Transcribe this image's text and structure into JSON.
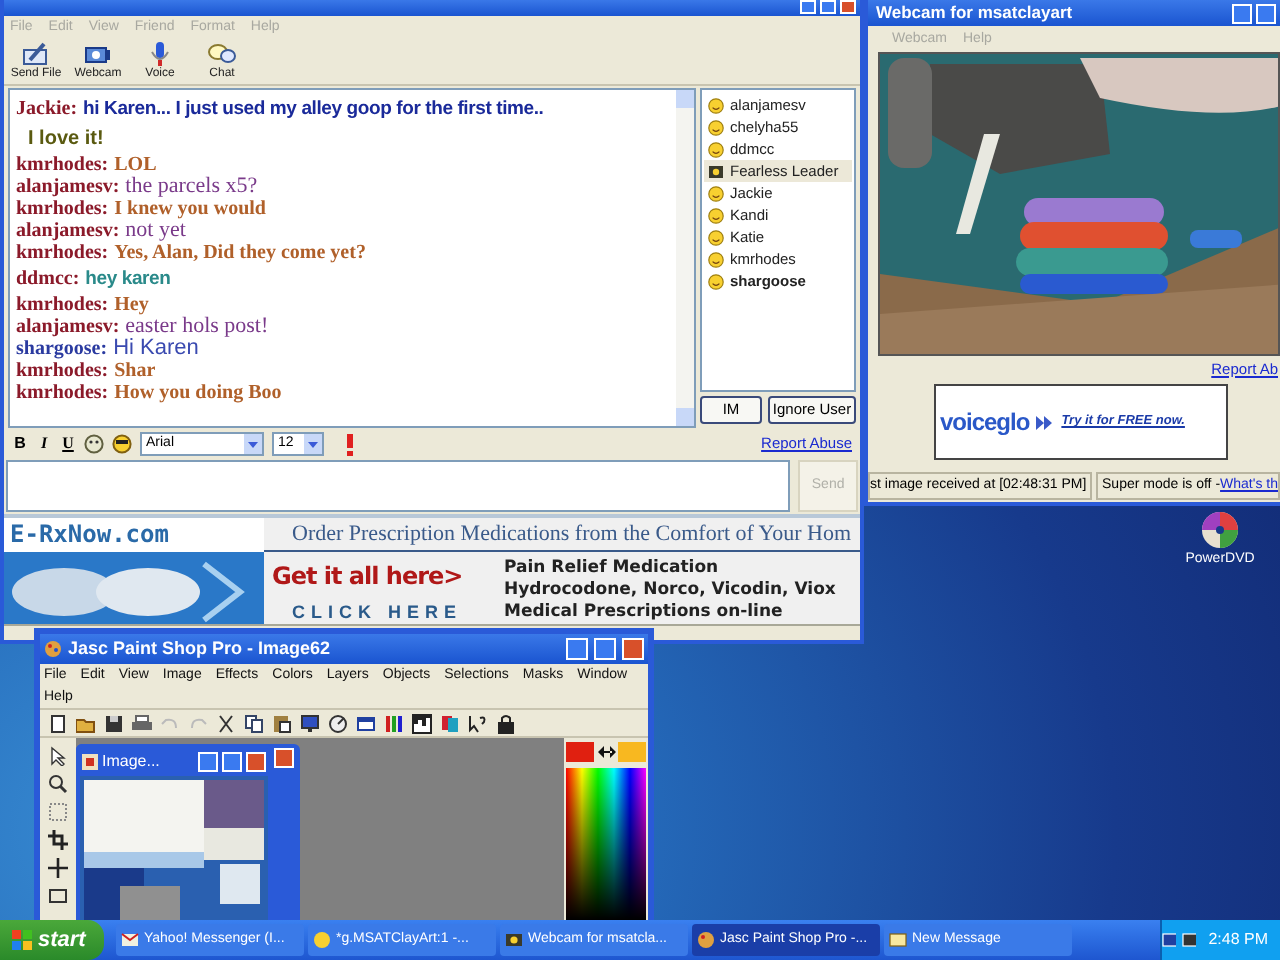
{
  "chat_window": {
    "menu": [
      "File",
      "Edit",
      "View",
      "Friend",
      "Format",
      "Help"
    ],
    "toolbar": [
      {
        "label": "Send File",
        "kind": "send"
      },
      {
        "label": "Webcam",
        "kind": "webcam"
      },
      {
        "label": "Voice",
        "kind": "voice"
      },
      {
        "label": "Chat",
        "kind": "chat"
      }
    ],
    "messages": [
      {
        "kind": "big",
        "user": "Jackie:",
        "text": "hi Karen... I just used my alley goop for the first time..",
        "color": "#1a2a9a"
      },
      {
        "kind": "more",
        "text": "I love it!",
        "color": "#5a5a10"
      },
      {
        "kind": "bold",
        "user": "kmrhodes:",
        "text": "LOL",
        "color": "#b0602a"
      },
      {
        "kind": "serif",
        "user": "alanjamesv:",
        "text": "the parcels x5?",
        "color": "#7a3a8a"
      },
      {
        "kind": "bold",
        "user": "kmrhodes:",
        "text": "I knew you would",
        "color": "#b0602a"
      },
      {
        "kind": "serif",
        "user": "alanjamesv:",
        "text": "not yet",
        "color": "#7a3a8a"
      },
      {
        "kind": "bold",
        "user": "kmrhodes:",
        "text": "Yes, Alan, Did they come yet?",
        "color": "#b0602a"
      },
      {
        "kind": "big",
        "user": "ddmcc:",
        "text": "hey karen",
        "color": "#2a8a8a"
      },
      {
        "kind": "bold",
        "user": "kmrhodes:",
        "text": "Hey",
        "color": "#b0602a"
      },
      {
        "kind": "serif",
        "user": "alanjamesv:",
        "text": "easter hols post!",
        "color": "#7a3a8a"
      },
      {
        "kind": "sans",
        "user": "shargoose:",
        "text": "Hi Karen",
        "color": "#3a4ab0"
      },
      {
        "kind": "bold",
        "user": "kmrhodes:",
        "text": "Shar",
        "color": "#b0602a"
      },
      {
        "kind": "bold",
        "user": "kmrhodes:",
        "text": "How you doing Boo",
        "color": "#b0602a"
      }
    ],
    "users": [
      {
        "name": "alanjamesv",
        "kind": "smiley",
        "selected": false,
        "bold": false
      },
      {
        "name": "chelyha55",
        "kind": "smiley",
        "selected": false,
        "bold": false
      },
      {
        "name": "ddmcc",
        "kind": "smiley",
        "selected": false,
        "bold": false
      },
      {
        "name": "Fearless Leader",
        "kind": "webcam",
        "selected": true,
        "bold": false
      },
      {
        "name": "Jackie",
        "kind": "smiley",
        "selected": false,
        "bold": false
      },
      {
        "name": "Kandi",
        "kind": "smiley",
        "selected": false,
        "bold": false
      },
      {
        "name": "Katie",
        "kind": "smiley",
        "selected": false,
        "bold": false
      },
      {
        "name": "kmrhodes",
        "kind": "smiley",
        "selected": false,
        "bold": false
      },
      {
        "name": "shargoose",
        "kind": "smiley",
        "selected": false,
        "bold": true
      }
    ],
    "buttons": [
      "IM",
      "Ignore User"
    ],
    "format_bar": {
      "buttons": [
        "B",
        "I",
        "U"
      ],
      "font": "Arial",
      "size": "12",
      "report_link": "Report Abuse"
    },
    "send_button": {
      "label": "Send",
      "disabled": true
    },
    "ad": {
      "site": "E-RxNow.com",
      "tagline": "Order Prescription Medications from the Comfort of Your Hom",
      "headline": "Get it all here>",
      "cta": "CLICK HERE",
      "lines": [
        "Pain Relief Medication",
        "Hydrocodone, Norco, Vicodin, Viox",
        "Medical Prescriptions on-line"
      ]
    }
  },
  "webcam_window": {
    "title": "Webcam for msatclayart",
    "menu": [
      "Webcam",
      "Help"
    ],
    "report_link": "Report Ab",
    "ad": {
      "logo": "voiceglo",
      "cta": "Try it for FREE now."
    },
    "status": "st image received at [02:48:31 PM]",
    "mode": "Super mode is off - ",
    "mode_link": "What's th"
  },
  "desktop_icons": [
    {
      "label": "PowerDVD"
    }
  ],
  "psp_window": {
    "title": "Jasc Paint Shop Pro - Image62",
    "menu": [
      "File",
      "Edit",
      "View",
      "Image",
      "Effects",
      "Colors",
      "Layers",
      "Objects",
      "Selections",
      "Masks",
      "Window",
      "Help"
    ],
    "image_window": {
      "title": "Image..."
    }
  },
  "taskbar": {
    "start": "start",
    "tasks": [
      {
        "label": "Yahoo! Messenger (I...",
        "kind": "yahoo",
        "selected": false
      },
      {
        "label": "*g.MSATClayArt:1 -...",
        "kind": "chat",
        "selected": false
      },
      {
        "label": "Webcam for msatcla...",
        "kind": "webcam",
        "selected": false
      },
      {
        "label": "Jasc Paint Shop Pro -...",
        "kind": "psp",
        "selected": true
      },
      {
        "label": "New Message",
        "kind": "mail",
        "selected": false
      }
    ],
    "clock": "2:48 PM"
  }
}
